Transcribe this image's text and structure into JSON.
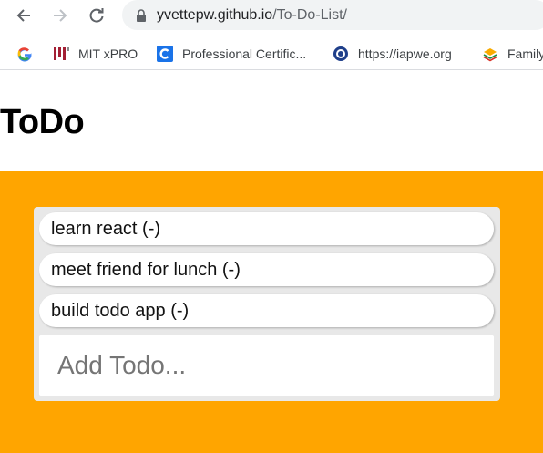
{
  "browser": {
    "url_host": "yvettepw.github.io",
    "url_path": "/To-Do-List/",
    "bookmarks": [
      {
        "label": "",
        "icon": "google-icon"
      },
      {
        "label": "MIT xPRO",
        "icon": "mit-icon"
      },
      {
        "label": "Professional Certific...",
        "icon": "c-logo-icon"
      },
      {
        "label": "https://iapwe.org",
        "icon": "iapwe-icon"
      },
      {
        "label": "Family",
        "icon": "layers-icon"
      }
    ]
  },
  "page": {
    "title": "ToDo"
  },
  "todos": [
    {
      "text": "learn react (-)"
    },
    {
      "text": "meet friend for lunch (-)"
    },
    {
      "text": "build todo app (-)"
    }
  ],
  "add_todo": {
    "placeholder": "Add Todo...",
    "value": ""
  },
  "colors": {
    "app_background": "#ffa500",
    "list_background": "#e8e8e8"
  }
}
